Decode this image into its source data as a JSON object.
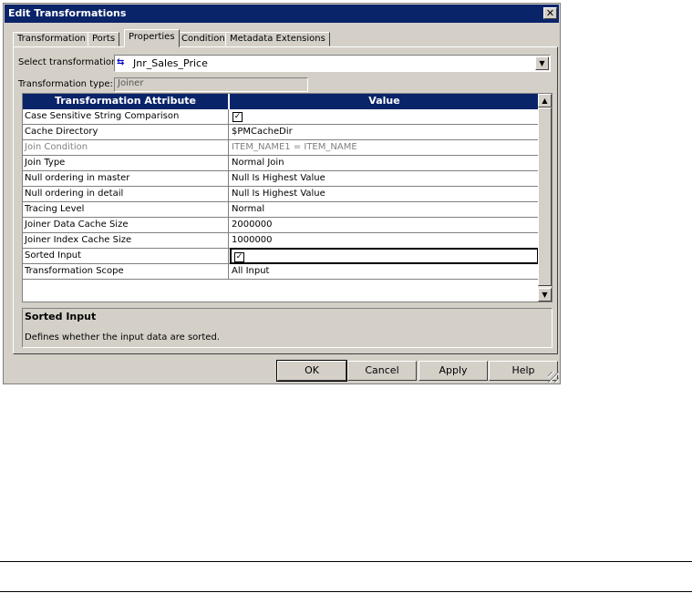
{
  "window": {
    "title": "Edit Transformations",
    "close_label": "✕"
  },
  "tabs": [
    {
      "label": "Transformation"
    },
    {
      "label": "Ports"
    },
    {
      "label": "Properties",
      "active": true
    },
    {
      "label": "Condition"
    },
    {
      "label": "Metadata Extensions"
    }
  ],
  "select": {
    "label": "Select transformation:",
    "value": "Jnr_Sales_Price",
    "icon": "joiner-icon"
  },
  "type": {
    "label": "Transformation type:",
    "value": "Joiner"
  },
  "grid": {
    "headers": [
      "Transformation Attribute",
      "Value"
    ],
    "rows": [
      {
        "attribute": "Case Sensitive String Comparison",
        "value": "",
        "checkbox": true,
        "checked": true
      },
      {
        "attribute": "Cache Directory",
        "value": "$PMCacheDir"
      },
      {
        "attribute": "Join Condition",
        "value": "ITEM_NAME1 = ITEM_NAME",
        "disabled": true
      },
      {
        "attribute": "Join Type",
        "value": "Normal Join"
      },
      {
        "attribute": "Null ordering in master",
        "value": "Null Is Highest Value"
      },
      {
        "attribute": "Null ordering in detail",
        "value": "Null Is Highest Value"
      },
      {
        "attribute": "Tracing Level",
        "value": "Normal"
      },
      {
        "attribute": "Joiner Data Cache Size",
        "value": "2000000"
      },
      {
        "attribute": "Joiner Index Cache Size",
        "value": "1000000"
      },
      {
        "attribute": "Sorted Input",
        "value": "",
        "checkbox": true,
        "checked": true,
        "selected": true
      },
      {
        "attribute": "Transformation Scope",
        "value": "All Input"
      }
    ]
  },
  "description": {
    "title": "Sorted Input",
    "text": "Defines whether the input data are sorted."
  },
  "buttons": {
    "ok": "OK",
    "cancel": "Cancel",
    "apply": "Apply",
    "help": "Help"
  },
  "glyphs": {
    "check": "✓",
    "arrow_up": "▲",
    "arrow_down": "▼",
    "joiner": "⇆"
  }
}
